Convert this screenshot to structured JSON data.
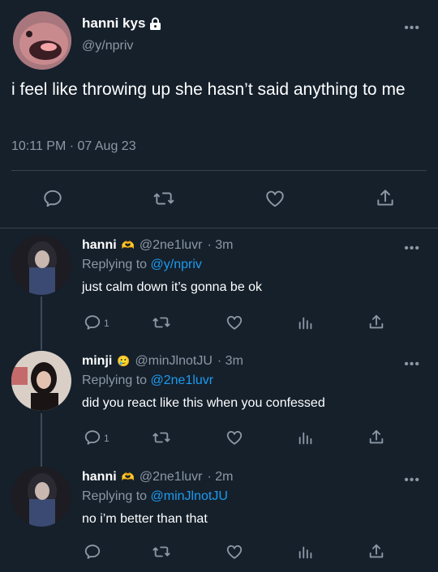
{
  "main": {
    "name": "hanni kys",
    "handle": "@y/npriv",
    "text": "i feel like throwing up she hasn’t said anything to me",
    "timestamp": "10:11 PM · 07 Aug 23",
    "more": "•••"
  },
  "replies": [
    {
      "name": "hanni",
      "badge_emoji": "🫶",
      "handle": "@2ne1luvr",
      "time": "· 3m",
      "replying_label": "Replying to",
      "replying_to": "@y/npriv",
      "text": "just calm down it’s gonna be ok",
      "reply_count": "1",
      "more": "•••"
    },
    {
      "name": "minji",
      "badge_emoji": "🥲",
      "handle": "@minJlnotJU",
      "time": "· 3m",
      "replying_label": "Replying to",
      "replying_to": "@2ne1luvr",
      "text": "did you react like this when you confessed",
      "reply_count": "1",
      "more": "•••"
    },
    {
      "name": "hanni",
      "badge_emoji": "🫶",
      "handle": "@2ne1luvr",
      "time": "· 2m",
      "replying_label": "Replying to",
      "replying_to": "@minJlnotJU",
      "text": "no i’m better than that",
      "reply_count": "",
      "more": "•••"
    }
  ]
}
